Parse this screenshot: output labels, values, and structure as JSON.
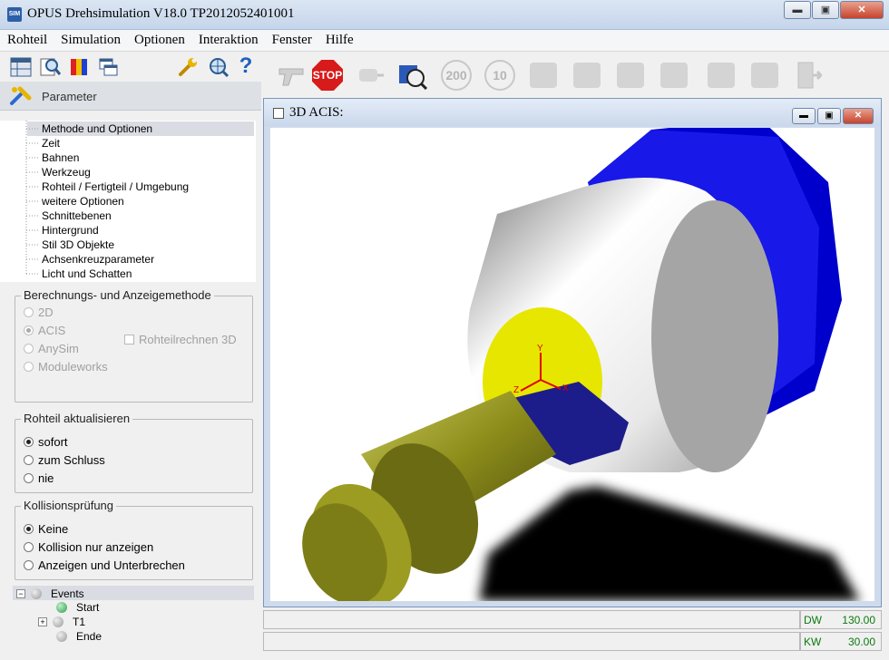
{
  "window": {
    "app_icon": "SIM",
    "title": "OPUS Drehsimulation V18.0  TP2012052401001",
    "minimize": "▬",
    "maximize": "▣",
    "close": "✕"
  },
  "menu": [
    "Rohteil",
    "Simulation",
    "Optionen",
    "Interaktion",
    "Fenster",
    "Hilfe"
  ],
  "left_toolbar": {
    "icons": [
      "table-icon",
      "magnifier-icon",
      "colors-icon",
      "windows-icon",
      "wrench-icon",
      "zoom-globe-icon",
      "help-icon"
    ],
    "help_glyph": "?"
  },
  "right_toolbar": {
    "stop_label": "STOP",
    "btn_200": "200",
    "btn_10": "10",
    "icons": [
      "gun-icon",
      "stop-icon",
      "disabled-plug-icon",
      "camera-icon",
      "step-200-icon",
      "step-10-icon",
      "tool-change-icon",
      "tool-stop-icon",
      "tool-icon",
      "tool-alt-icon",
      "spindle-icon",
      "machine-icon",
      "exit-icon"
    ]
  },
  "panel": {
    "title": "Parameter",
    "tree": [
      "Methode und Optionen",
      "Zeit",
      "Bahnen",
      "Werkzeug",
      "Rohteil / Fertigteil / Umgebung",
      "weitere Optionen",
      "Schnittebenen",
      "Hintergrund",
      "Stil 3D Objekte",
      "Achsenkreuzparameter",
      "Licht und Schatten"
    ],
    "selected_index": 0
  },
  "group_method": {
    "title": "Berechnungs- und Anzeigemethode",
    "options": [
      "2D",
      "ACIS",
      "AnySim",
      "Moduleworks"
    ],
    "selected": "ACIS",
    "checkbox_label": "Rohteilrechnen 3D",
    "checkbox_checked": false
  },
  "group_update": {
    "title": "Rohteil aktualisieren",
    "options": [
      "sofort",
      "zum Schluss",
      "nie"
    ],
    "selected": "sofort"
  },
  "group_collision": {
    "title": "Kollisionsprüfung",
    "options": [
      "Keine",
      "Kollision nur anzeigen",
      "Anzeigen und Unterbrechen"
    ],
    "selected": "Keine"
  },
  "events": {
    "root": "Events",
    "root_expander": "−",
    "child_expander": "+",
    "children": [
      "Start",
      "T1",
      "Ende"
    ]
  },
  "viewer": {
    "title": "3D ACIS:",
    "axes": {
      "x": "X",
      "y": "Y",
      "z": "Z"
    }
  },
  "status": {
    "dw_label": "DW",
    "dw_value": "130.00",
    "kw_label": "KW",
    "kw_value": "30.00"
  },
  "colors": {
    "chuck": "#1010d8",
    "drum": "#c9c9c9",
    "face": "#e6e600",
    "tool_holder": "#8b8b1a",
    "insert": "#1c1c8a",
    "status_green": "#0b7a10"
  }
}
